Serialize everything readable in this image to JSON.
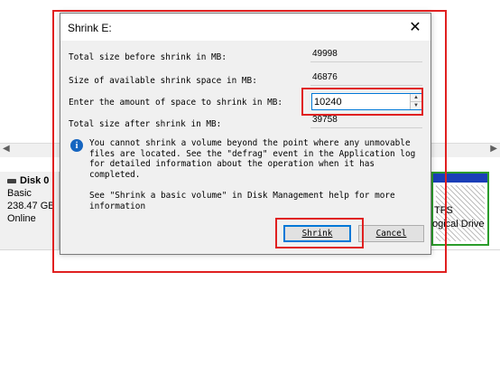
{
  "dialog": {
    "title": "Shrink E:",
    "close_glyph": "✕",
    "rows": [
      {
        "label": "Total size before shrink in MB:",
        "value": "49998"
      },
      {
        "label": "Size of available shrink space in MB:",
        "value": "46876"
      }
    ],
    "amount_label": "Enter the amount of space to shrink in MB:",
    "amount_value": "10240",
    "after_label": "Total size after shrink in MB:",
    "after_value": "39758",
    "info_icon_glyph": "i",
    "info_text": "You cannot shrink a volume beyond the point where any unmovable files are located. See the \"defrag\" event in the Application log for detailed information about the operation when it has completed.",
    "help_text": "See \"Shrink a basic volume\" in Disk Management help for more information",
    "shrink_label": "Shrink",
    "cancel_label": "Cancel"
  },
  "disk": {
    "name": "Disk 0",
    "type": "Basic",
    "size": "238.47 GB",
    "status": "Online",
    "partition_fs": "TFS",
    "partition_type": "ogical Drive"
  },
  "colors": {
    "annotation_red": "#e02020",
    "partition_border": "#2b9c2b",
    "partition_head": "#1a3fb8",
    "focus_blue": "#0078d7"
  }
}
